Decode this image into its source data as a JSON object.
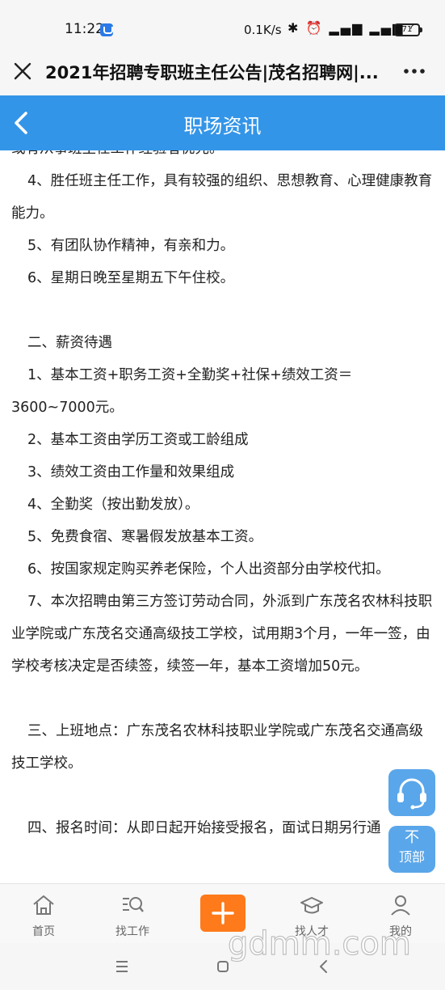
{
  "status_bar": {
    "time": "11:22",
    "net_speed": "0.1K/s",
    "indicators": "✱ ⏰ ▂▄▆ ▂▄▆ ◠",
    "battery": "71"
  },
  "browser": {
    "title": "2021年招聘专职班主任公告|茂名招聘网|..."
  },
  "header": {
    "title": "职场资讯"
  },
  "article": {
    "p0": "或有从事班主任工作经验者优先。",
    "p1": "4、胜任班主任工作，具有较强的组织、思想教育、心理健康教育能力。",
    "p2": "5、有团队协作精神，有亲和力。",
    "p3": "6、星期日晚至星期五下午住校。",
    "s2": "二、薪资待遇",
    "p4": "1、基本工资+职务工资+全勤奖+社保+绩效工资＝3600~7000元。",
    "p5": "2、基本工资由学历工资或工龄组成",
    "p6": "3、绩效工资由工作量和效果组成",
    "p7": "4、全勤奖（按出勤发放）。",
    "p8": "5、免费食宿、寒暑假发放基本工资。",
    "p9": "6、按国家规定购买养老保险，个人出资部分由学校代扣。",
    "p10": "7、本次招聘由第三方签订劳动合同，外派到广东茂名农林科技职业学院或广东茂名交通高级技工学校，试用期3个月，一年一签，由学校考核决定是否续签，续签一年，基本工资增加50元。",
    "s3": "三、上班地点：广东茂名农林科技职业学院或广东茂名交通高级技工学校。",
    "s4": "四、报名时间：从即日起开始接受报名，面试日期另行通"
  },
  "floating": {
    "back_to_top_arrow": "不",
    "back_to_top_label": "顶部"
  },
  "nav": {
    "items": [
      {
        "label": "首页",
        "icon": "home-icon"
      },
      {
        "label": "找工作",
        "icon": "job-search-icon"
      },
      {
        "label": "",
        "icon": "add-icon"
      },
      {
        "label": "找人才",
        "icon": "graduation-cap-icon"
      },
      {
        "label": "我的",
        "icon": "user-icon"
      }
    ]
  },
  "watermark": "gdmm.com",
  "colors": {
    "header_blue": "#3395e8",
    "add_orange": "#ff7a1a",
    "fab_blue": "#5aa6ea"
  }
}
